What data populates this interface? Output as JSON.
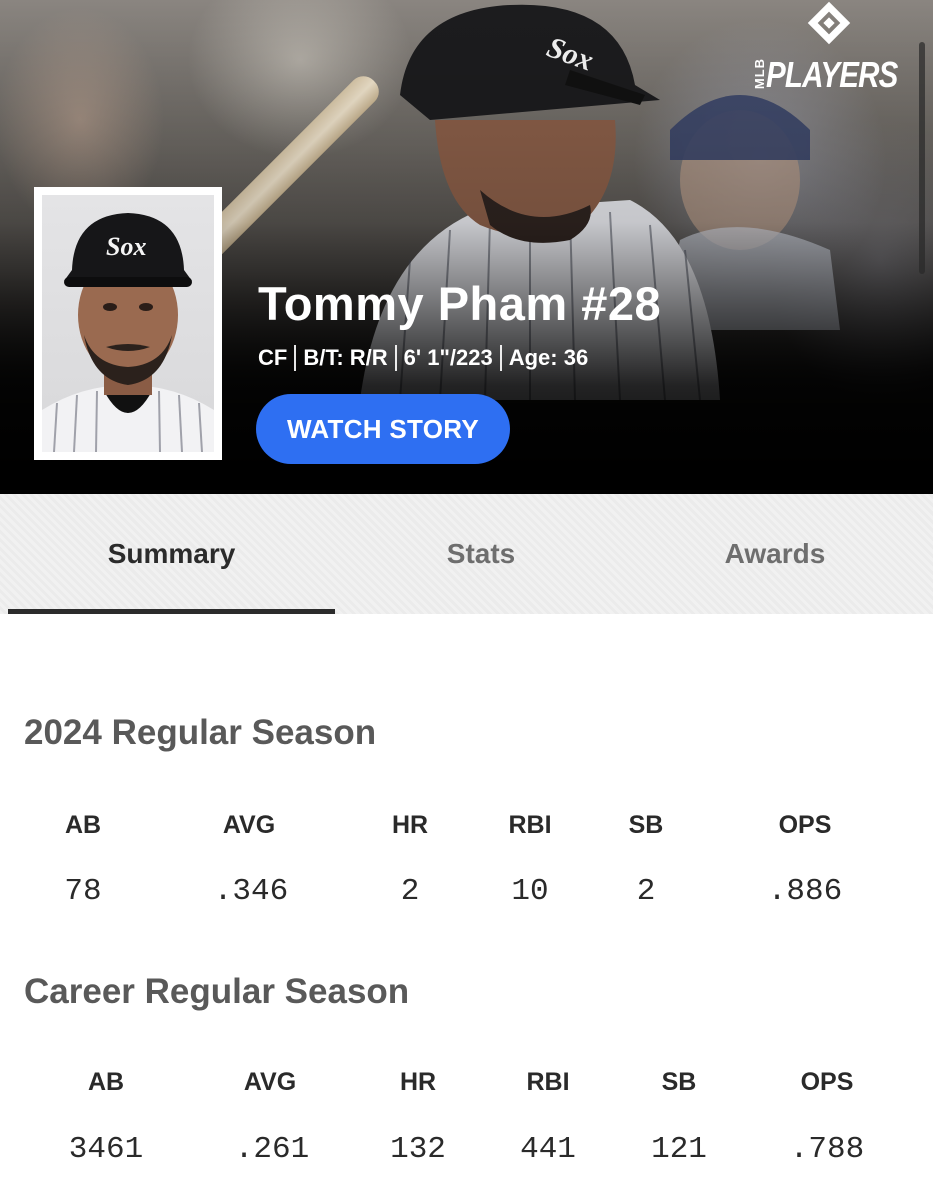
{
  "brand": {
    "mlb": "MLB",
    "players": "PLAYERS"
  },
  "player": {
    "name": "Tommy Pham #28",
    "bio": [
      "CF",
      "B/T: R/R",
      "6' 1\"/223",
      "Age: 36"
    ]
  },
  "hero": {
    "watch_label": "WATCH STORY"
  },
  "tabs": [
    {
      "label": "Summary",
      "active": true
    },
    {
      "label": "Stats",
      "active": false
    },
    {
      "label": "Awards",
      "active": false
    }
  ],
  "sections": [
    {
      "title": "2024 Regular Season",
      "headers": [
        "AB",
        "AVG",
        "HR",
        "RBI",
        "SB",
        "OPS"
      ],
      "values": [
        "78",
        ".346",
        "2",
        "10",
        "2",
        ".886"
      ]
    },
    {
      "title": "Career Regular Season",
      "headers": [
        "AB",
        "AVG",
        "HR",
        "RBI",
        "SB",
        "OPS"
      ],
      "values": [
        "3461",
        ".261",
        "132",
        "441",
        "121",
        ".788"
      ]
    }
  ],
  "colors": {
    "accent": "#2e6ff2",
    "tab_active": "#2b2b2b",
    "section_title": "#595959"
  },
  "icons": {
    "logo": "mlb-players-diamond-icon",
    "team_cap": "sox-logo-icon"
  }
}
